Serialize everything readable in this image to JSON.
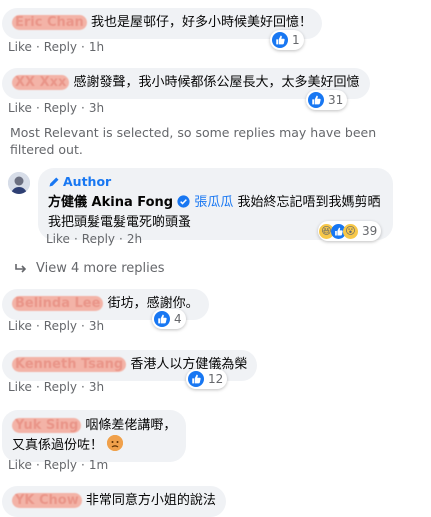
{
  "actions": {
    "like": "Like",
    "reply": "Reply",
    "dot": "·"
  },
  "comments": [
    {
      "name": "Eric Chan",
      "text": "我也是屋邨仔，好多小時候美好回憶！",
      "time": "1h",
      "reactions": "1"
    },
    {
      "name": "XX Xxx",
      "text": "感謝發聲，我小時候都係公屋長大，太多美好回憶",
      "time": "3h",
      "reactions": "31"
    },
    {
      "name": "Belinda Lee",
      "text": "街坊，感謝你。",
      "time": "3h",
      "reactions": "4"
    },
    {
      "name": "Kenneth Tsang",
      "text": "香港人以方健儀為榮",
      "time": "3h",
      "reactions": "12"
    },
    {
      "name": "Yuk Sing",
      "text_line1": "咽條差佬講嘢，",
      "text_line2": "又真係過份咗！",
      "time": "1m"
    },
    {
      "name": "YK Chow",
      "text": "非常同意方小姐的說法"
    }
  ],
  "filter_notice": "Most Relevant is selected, so some replies may have been filtered out.",
  "reply": {
    "badge": "Author",
    "name": "方健儀 Akina Fong",
    "tag": "張瓜瓜",
    "text_line1": "我始終忘記唔到我媽剪晒",
    "text_line2": "我把頭髮電髮電死啲頭蚤",
    "time": "2h",
    "reactions": "39"
  },
  "view_more": "View 4 more replies",
  "colors": {
    "accent": "#1877f2",
    "bubble": "#f0f2f5",
    "meta": "#65676b"
  }
}
